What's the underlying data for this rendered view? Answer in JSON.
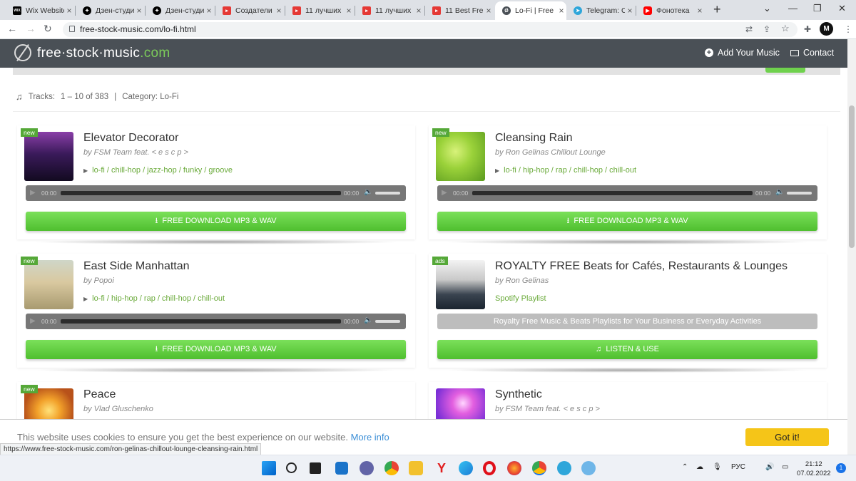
{
  "browser": {
    "tabs": [
      {
        "title": "Wix Website",
        "favicon_color": "#000000",
        "favicon_text": "WIX"
      },
      {
        "title": "Дзен-студия",
        "favicon_color": "#000000",
        "favicon_text": "✦"
      },
      {
        "title": "Дзен-студия",
        "favicon_color": "#000000",
        "favicon_text": "✦"
      },
      {
        "title": "Создатели",
        "favicon_color": "#e53935",
        "favicon_text": "▸"
      },
      {
        "title": "11 лучших",
        "favicon_color": "#e53935",
        "favicon_text": "▸"
      },
      {
        "title": "11 лучших",
        "favicon_color": "#e53935",
        "favicon_text": "▸"
      },
      {
        "title": "11 Best Free",
        "favicon_color": "#e53935",
        "favicon_text": "▸"
      },
      {
        "title": "Lo-Fi | Free",
        "favicon_color": "#4a5056",
        "favicon_text": "Ø"
      },
      {
        "title": "Telegram: C",
        "favicon_color": "#2ea6da",
        "favicon_text": "➤"
      },
      {
        "title": "Фонотека",
        "favicon_color": "#ff0000",
        "favicon_text": "▶"
      }
    ],
    "active_tab": 7,
    "url": "free-stock-music.com/lo-fi.html",
    "avatar_letter": "M"
  },
  "site": {
    "logo": {
      "part1": "free·stock·music",
      "part2": ".com"
    },
    "nav": {
      "add_music": "Add Your Music",
      "contact": "Contact"
    },
    "tracks_info": {
      "label": "Tracks:",
      "range": "1 – 10 of 383",
      "sep": "|",
      "category": "Category: Lo-Fi"
    }
  },
  "cards": [
    {
      "badge": "new",
      "title": "Elevator Decorator",
      "artist": "by FSM Team feat. < e s c p >",
      "tags": "lo-fi / chill-hop / jazz-hop / funky / groove",
      "time_start": "00:00",
      "time_end": "00:00",
      "button": "FREE DOWNLOAD  MP3 & WAV",
      "type": "track"
    },
    {
      "badge": "new",
      "title": "Cleansing Rain",
      "artist": "by Ron Gelinas Chillout Lounge",
      "tags": "lo-fi / hip-hop / rap / chill-hop / chill-out",
      "time_start": "00:00",
      "time_end": "00:00",
      "button": "FREE DOWNLOAD  MP3 & WAV",
      "type": "track"
    },
    {
      "badge": "new",
      "title": "East Side Manhattan",
      "artist": "by Popoi",
      "tags": "lo-fi / hip-hop / rap / chill-hop / chill-out",
      "time_start": "00:00",
      "time_end": "00:00",
      "button": "FREE DOWNLOAD  MP3 & WAV",
      "type": "track"
    },
    {
      "badge": "ads",
      "title": "ROYALTY FREE Beats for Cafés, Restaurants & Lounges",
      "artist": "by Ron Gelinas",
      "tags": "Spotify Playlist",
      "info_bar": "Royalty Free Music & Beats Playlists for Your Business or Everyday Activities",
      "button": "LISTEN & USE",
      "type": "ad"
    },
    {
      "badge": "new",
      "title": "Peace",
      "artist": "by Vlad Gluschenko",
      "type": "partial"
    },
    {
      "title": "Synthetic",
      "artist": "by FSM Team feat. < e s c p >",
      "type": "partial"
    }
  ],
  "cookie": {
    "text": "This website uses cookies to ensure you get the best experience on our website.",
    "link": "More info",
    "button": "Got it!"
  },
  "status_url": "https://www.free-stock-music.com/ron-gelinas-chillout-lounge-cleansing-rain.html",
  "taskbar": {
    "lang": "РУС",
    "time": "21:12",
    "date": "07.02.2022",
    "notifications": "1"
  }
}
